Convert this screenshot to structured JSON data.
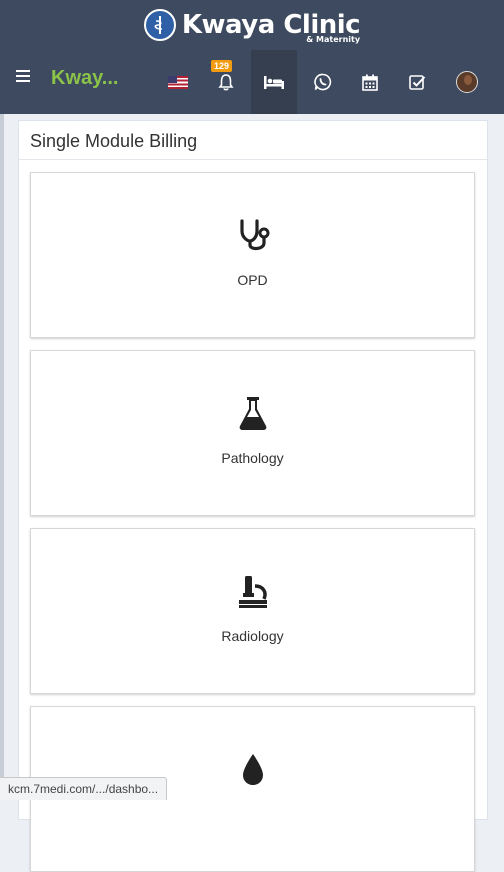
{
  "header": {
    "logo_title": "Kwaya Clinic",
    "logo_subtitle": "& Maternity",
    "brand": "Kway...",
    "notification_count": "129",
    "nav_icons": [
      "flag-us-icon",
      "bell-icon",
      "bed-icon",
      "whatsapp-icon",
      "calendar-icon",
      "checkbox-icon",
      "user-avatar"
    ]
  },
  "panel": {
    "title": "Single Module Billing",
    "modules": [
      {
        "label": "OPD",
        "icon": "stethoscope-icon"
      },
      {
        "label": "Pathology",
        "icon": "flask-icon"
      },
      {
        "label": "Radiology",
        "icon": "microscope-icon"
      },
      {
        "label": "",
        "icon": "blood-drop-icon"
      }
    ]
  },
  "statusbar": {
    "url": "kcm.7medi.com/.../dashbo..."
  },
  "colors": {
    "header_bg": "#3d4a5f",
    "brand": "#8bc34a",
    "badge": "#f39c12",
    "icon": "#222222"
  }
}
